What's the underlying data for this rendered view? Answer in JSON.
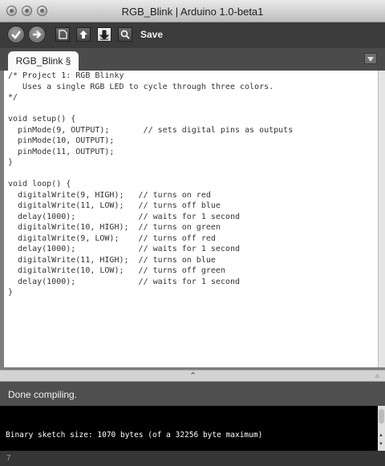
{
  "window": {
    "title": "RGB_Blink | Arduino 1.0-beta1"
  },
  "toolbar": {
    "buttons": [
      "verify",
      "upload",
      "new",
      "open",
      "save",
      "serial-monitor"
    ],
    "save_label": "Save"
  },
  "tabs": [
    {
      "label": "RGB_Blink §"
    }
  ],
  "editor": {
    "lines": [
      "/* Project 1: RGB Blinky",
      "   Uses a single RGB LED to cycle through three colors.",
      "*/",
      "",
      "void setup() {",
      "  pinMode(9, OUTPUT);       // sets digital pins as outputs",
      "  pinMode(10, OUTPUT);",
      "  pinMode(11, OUTPUT);",
      "}",
      "",
      "void loop() {",
      "  digitalWrite(9, HIGH);   // turns on red",
      "  digitalWrite(11, LOW);   // turns off blue",
      "  delay(1000);             // waits for 1 second",
      "  digitalWrite(10, HIGH);  // turns on green",
      "  digitalWrite(9, LOW);    // turns off red",
      "  delay(1000);             // waits for 1 second",
      "  digitalWrite(11, HIGH);  // turns on blue",
      "  digitalWrite(10, LOW);   // turns off green",
      "  delay(1000);             // waits for 1 second",
      "}"
    ]
  },
  "status": {
    "message": "Done compiling."
  },
  "console": {
    "output": "Binary sketch size: 1070 bytes (of a 32256 byte maximum)"
  },
  "footer": {
    "line_number": "7"
  }
}
